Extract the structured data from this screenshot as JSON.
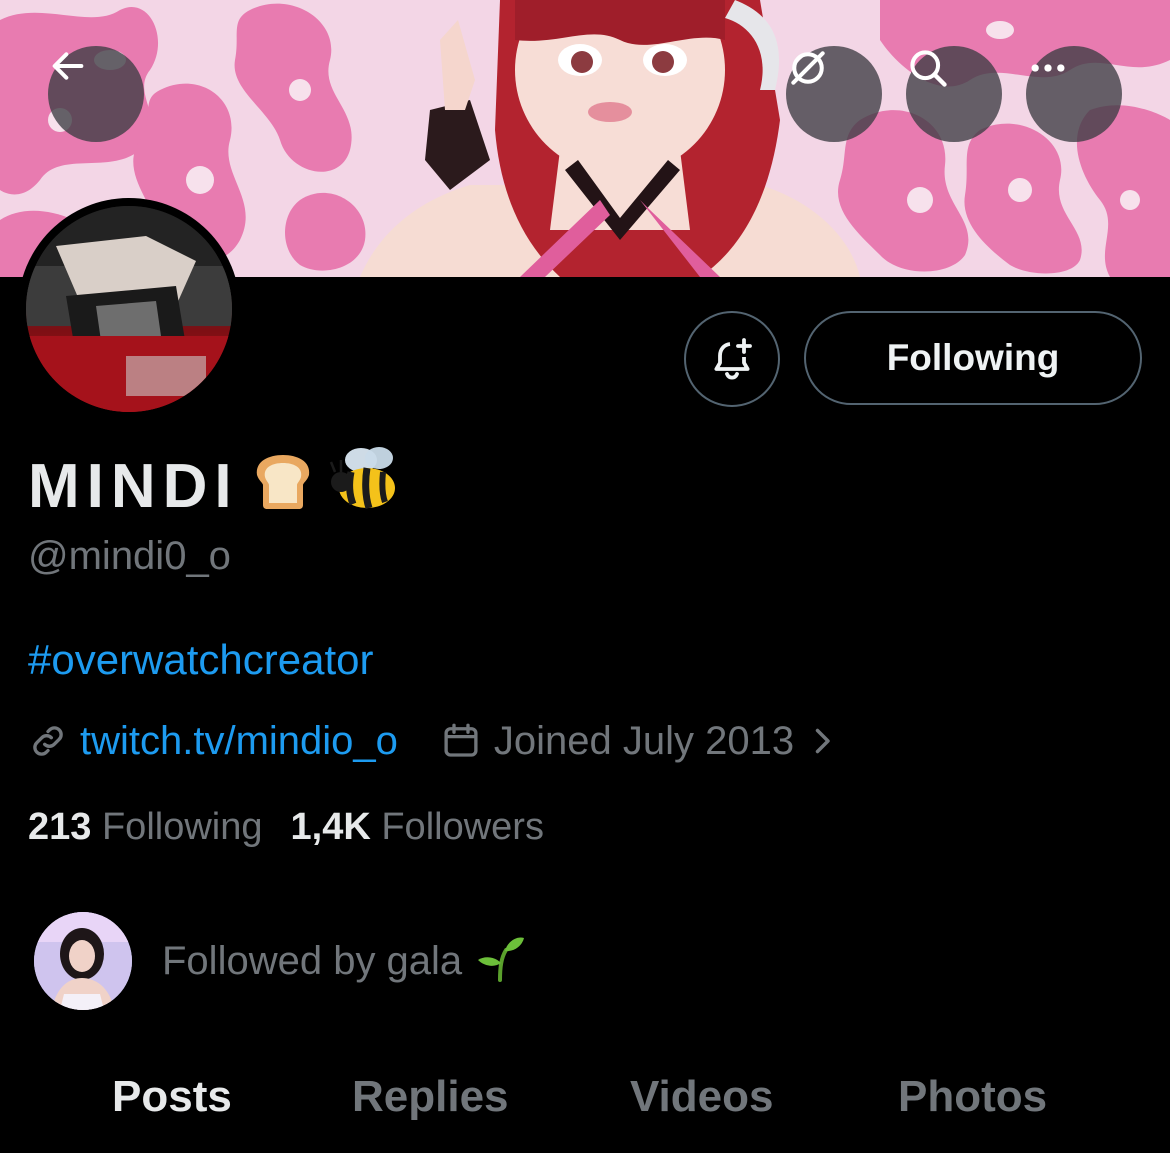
{
  "header": {
    "back_icon": "arrow-left-icon",
    "actions": [
      "grok-icon",
      "search-icon",
      "more-icon"
    ]
  },
  "profile": {
    "name": "MINDI",
    "name_emojis": [
      "bread",
      "bee"
    ],
    "handle": "@mindi0_o",
    "bio_hashtag": "#overwatchcreator",
    "link": "twitch.tv/mindio_o",
    "joined": "Joined July 2013",
    "following_count": "213",
    "following_label": "Following",
    "followers_count": "1,4K",
    "followers_label": "Followers"
  },
  "actions": {
    "notify_icon": "bell-plus-icon",
    "following_button": "Following"
  },
  "followed_by": {
    "text": "Followed by gala",
    "emoji": "seedling"
  },
  "tabs": [
    {
      "label": "Posts",
      "active": true
    },
    {
      "label": "Replies",
      "active": false
    },
    {
      "label": "Videos",
      "active": false
    },
    {
      "label": "Photos",
      "active": false
    }
  ],
  "colors": {
    "background": "#000000",
    "link": "#1d9bf0",
    "secondary_text": "#71767b",
    "banner_pink": "#e86aa6"
  }
}
